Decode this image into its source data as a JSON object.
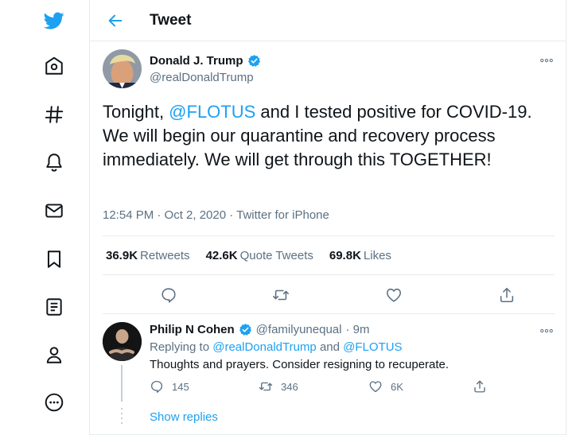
{
  "colors": {
    "accent": "#1da1f2",
    "text": "#0f1419",
    "muted": "#5b7083",
    "border": "#e6ecf0"
  },
  "nav": {
    "items": [
      {
        "icon": "twitter-bird-icon"
      },
      {
        "icon": "home-icon"
      },
      {
        "icon": "explore-hashtag-icon"
      },
      {
        "icon": "notifications-bell-icon"
      },
      {
        "icon": "messages-envelope-icon"
      },
      {
        "icon": "bookmarks-icon"
      },
      {
        "icon": "lists-icon"
      },
      {
        "icon": "profile-icon"
      },
      {
        "icon": "more-icon"
      }
    ]
  },
  "header": {
    "title": "Tweet"
  },
  "tweet": {
    "author_name": "Donald J. Trump",
    "author_handle": "@realDonaldTrump",
    "text_before": "Tonight, ",
    "mention": "@FLOTUS",
    "text_after": " and I tested positive for COVID-19. We will begin our quarantine and recovery process immediately. We will get through this TOGETHER!",
    "meta": "12:54 PM · Oct 2, 2020 · Twitter for iPhone",
    "stats": {
      "retweets_count": "36.9K",
      "retweets_label": "Retweets",
      "quotes_count": "42.6K",
      "quotes_label": "Quote Tweets",
      "likes_count": "69.8K",
      "likes_label": "Likes"
    }
  },
  "reply": {
    "author_name": "Philip N Cohen",
    "author_handle": "@familyunequal",
    "time": "· 9m",
    "replying_prefix": "Replying to ",
    "replying_to_1": "@realDonaldTrump",
    "replying_and": " and ",
    "replying_to_2": "@FLOTUS",
    "text": "Thoughts and prayers. Consider resigning to recuperate.",
    "reply_count": "145",
    "retweet_count": "346",
    "like_count": "6K",
    "show_replies": "Show replies"
  }
}
